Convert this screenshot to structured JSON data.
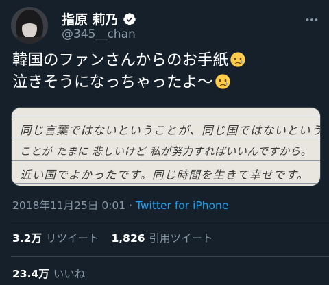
{
  "author": {
    "display_name": "指原 莉乃",
    "handle": "@345__chan",
    "verified": true,
    "avatar_icon": "avatar-photo"
  },
  "tweet": {
    "line1": "韓国のファンさんからのお手紙",
    "line2": "泣きそうになっちゃったよ〜",
    "emoji": "crying-face-emoji"
  },
  "media": {
    "handwritten_lines": [
      "同じ言葉ではないということが、同じ国ではないという",
      "ことが たまに 悲しいけど 私が努力すればいいんですから。",
      "近い国でよかったです。同じ時間を生きて幸せです。"
    ]
  },
  "meta": {
    "timestamp": "2018年11月25日 0:01",
    "separator": "·",
    "source": "Twitter for iPhone"
  },
  "stats": {
    "retweets_count": "3.2万",
    "retweets_label": "リツイート",
    "quotes_count": "1,826",
    "quotes_label": "引用ツイート",
    "likes_count": "23.4万",
    "likes_label": "いいね"
  },
  "colors": {
    "background": "#15202b",
    "secondary_text": "#8899a6",
    "accent": "#1da1f2",
    "border": "#38444d"
  }
}
